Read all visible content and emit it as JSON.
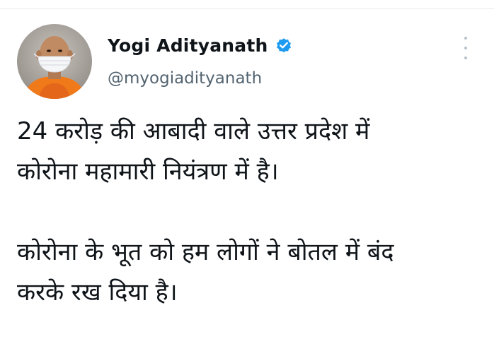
{
  "tweet": {
    "author": {
      "display_name": "Yogi Adityanath",
      "handle": "@myogiadityanath",
      "verified": true,
      "avatar_icon": "profile-photo-masked-person"
    },
    "more_icon": "more-vertical-icon",
    "body": {
      "paragraph1_line1": "24 करोड़ की आबादी वाले उत्तर प्रदेश में",
      "paragraph1_line2": "कोरोना महामारी नियंत्रण में है।",
      "paragraph2_line1": "कोरोना के भूत को हम लोगों ने बोतल में बंद",
      "paragraph2_line2": "करके रख दिया है।"
    }
  },
  "colors": {
    "verified_blue": "#1d9bf0",
    "handle_gray": "#536471",
    "text": "#0f1419",
    "divider": "#e6e9ec"
  }
}
